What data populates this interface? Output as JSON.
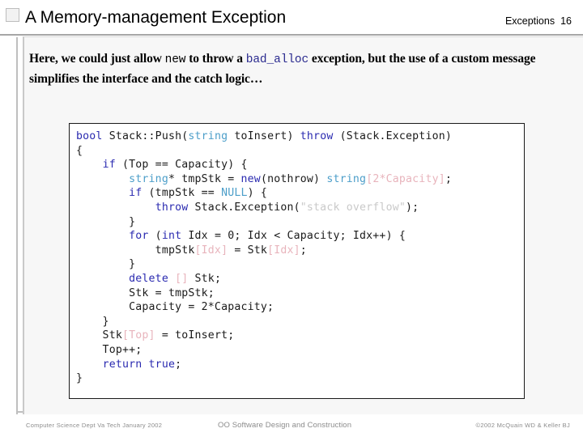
{
  "slide": {
    "title": "A Memory-management Exception",
    "topic": "Exceptions",
    "number": "16"
  },
  "body": {
    "part1": "Here, we could just allow ",
    "code1": "new",
    "part2": " to throw a ",
    "code2": "bad_alloc",
    "part3": " exception, but the use of a custom message simplifies the interface and the catch logic…"
  },
  "code_block": {
    "language": "C++",
    "lines": [
      "bool Stack::Push(string toInsert) throw (Stack.Exception)",
      "{",
      "    if (Top == Capacity) {",
      "        string* tmpStk = new(nothrow) string[2*Capacity];",
      "        if (tmpStk == NULL) {",
      "            throw Stack.Exception(\"stack overflow\");",
      "        }",
      "        for (int Idx = 0; Idx < Capacity; Idx++) {",
      "            tmpStk[Idx] = Stk[Idx];",
      "        }",
      "        delete [] Stk;",
      "        Stk = tmpStk;",
      "        Capacity = 2*Capacity;",
      "    }",
      "    Stk[Top] = toInsert;",
      "    Top++;",
      "    return true;",
      "}"
    ],
    "colors": {
      "keyword": "#2a2ab0",
      "type": "#4c9ec9",
      "bracket": "#e8b4bc",
      "string": "#c9c9c9",
      "plain": "#1a1a1a"
    }
  },
  "footer": {
    "left": "Computer Science Dept Va Tech January 2002",
    "center": "OO Software Design and Construction",
    "right": "©2002  McQuain WD & Keller BJ"
  }
}
